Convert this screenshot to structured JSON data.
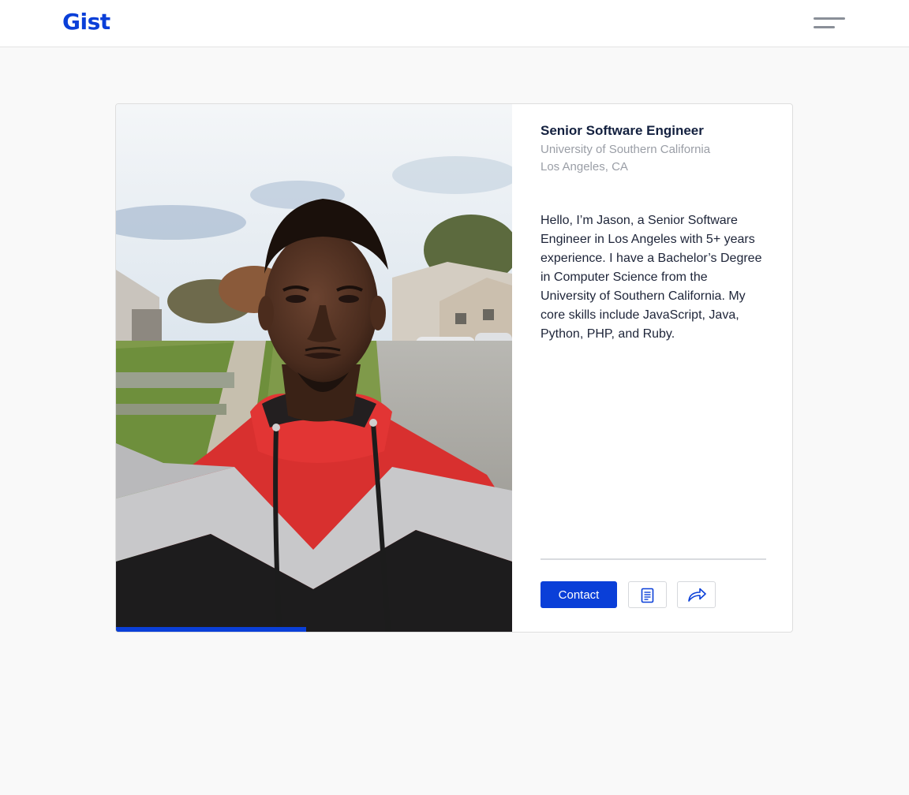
{
  "app": {
    "logo_text": "Gist"
  },
  "navbar": {
    "menu_icon": "hamburger-menu-icon"
  },
  "profile": {
    "title": "Senior Software Engineer",
    "school": "University of Southern California",
    "location": "Los Angeles, CA",
    "bio": "Hello, I’m Jason, a Senior Software Engineer in Los Angeles with 5+ years experience. I have a Bachelor’s Degree in Computer Science from the University of Southern California. My core skills include JavaScript, Java, Python, PHP, and Ruby.",
    "photo_progress": 0.48
  },
  "actions": {
    "contact_label": "Contact",
    "resume_icon": "document-icon",
    "share_icon": "share-arrow-icon"
  },
  "colors": {
    "accent": "#0a3fd8",
    "heading": "#13203f",
    "muted": "#9a9ea6",
    "body_text": "#1d2438",
    "page_background": "#f9f9f9"
  }
}
